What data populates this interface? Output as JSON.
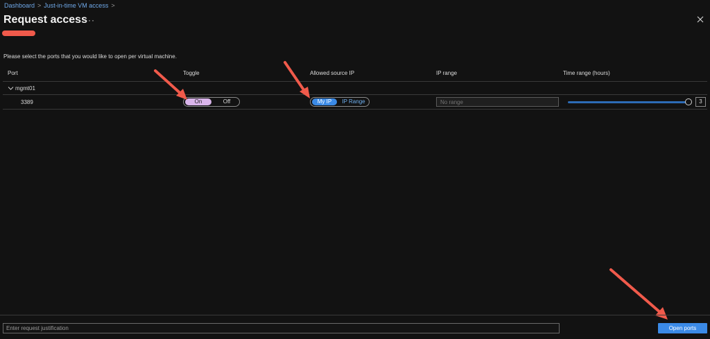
{
  "breadcrumb": {
    "items": [
      "Dashboard",
      "Just-in-time VM access"
    ]
  },
  "page": {
    "title": "Request access",
    "more_label": "···"
  },
  "instructions": "Please select the ports that you would like to open per virtual machine.",
  "table": {
    "columns": [
      "Port",
      "Toggle",
      "Allowed source IP",
      "IP range",
      "Time range (hours)"
    ],
    "group": "mgmt01",
    "rows": [
      {
        "port": "3389",
        "toggle_on_label": "On",
        "toggle_off_label": "Off",
        "toggle_selected": "On",
        "source_myip_label": "My IP",
        "source_iprange_label": "IP Range",
        "source_selected": "My IP",
        "ip_range_placeholder": "No range",
        "time_range_hours": "3"
      }
    ]
  },
  "footer": {
    "justification_placeholder": "Enter request justification",
    "open_ports_label": "Open ports"
  },
  "colors": {
    "accent": "#3b8ae6",
    "toggle_on": "#d9b4ea",
    "annotation_arrow": "#f05a4b",
    "background": "#121212"
  },
  "icons": [
    "chevron-right-icon",
    "more-icon",
    "close-icon",
    "chevron-down-icon",
    "annotation-arrow-icon"
  ]
}
